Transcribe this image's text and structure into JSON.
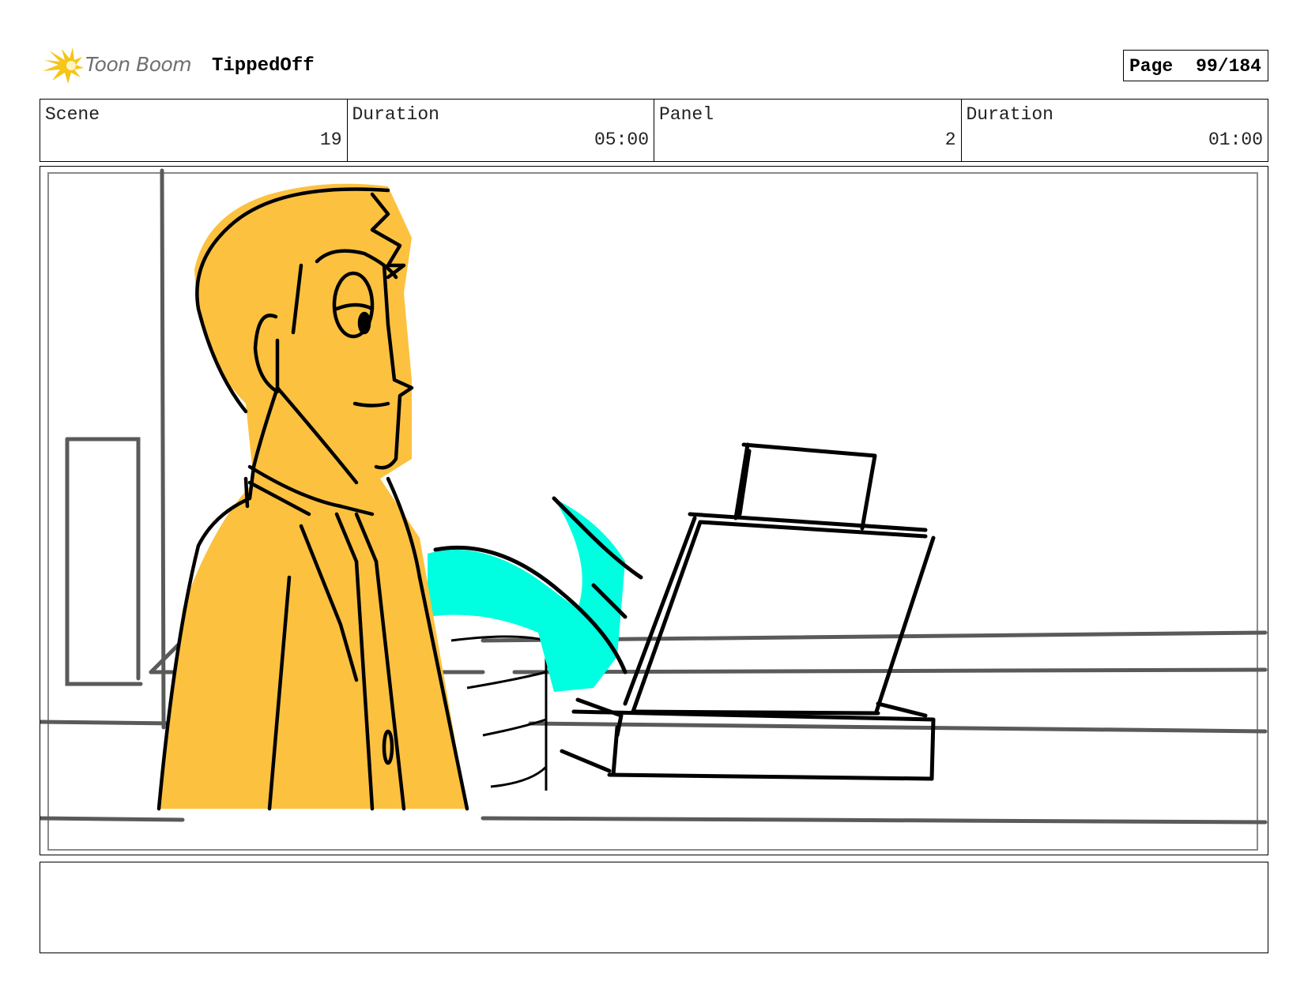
{
  "header": {
    "logo_text": "Toon Boom",
    "project_title": "TippedOff",
    "page_label": "Page",
    "page_number": "99/184"
  },
  "info": {
    "scene_label": "Scene",
    "scene_value": "19",
    "scene_duration_label": "Duration",
    "scene_duration_value": "05:00",
    "panel_label": "Panel",
    "panel_value": "2",
    "panel_duration_label": "Duration",
    "panel_duration_value": "01:00"
  },
  "colors": {
    "character_fill": "#FCC13F",
    "cyan_fill": "#00FFE0",
    "logo_star": "#F5C518",
    "line": "#000000",
    "background_line": "#5a5a5a"
  }
}
